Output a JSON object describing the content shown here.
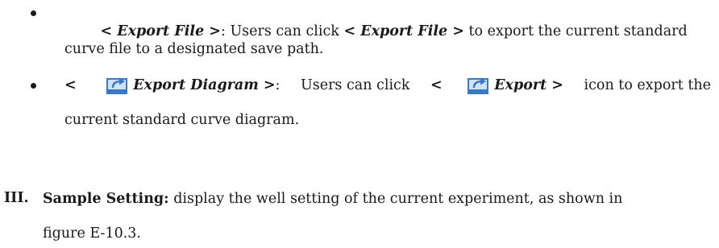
{
  "bullets": [
    {
      "lead_label": "< Export File >",
      "colon": ":",
      "line1_text": " Users can click ",
      "inline_label": "< Export File >",
      "line1_tail": " to export the current standard",
      "line2_text": "curve file to a designated save path."
    },
    {
      "open_bracket": "<",
      "lead_label": "Export Diagram >",
      "colon": ":",
      "mid_text": "Users can click",
      "inline_open": "<",
      "inline_label": "Export >",
      "tail_text": "icon to export the",
      "line2_text": "current standard curve diagram."
    }
  ],
  "section": {
    "numeral": "III.",
    "title": "Sample Setting:",
    "line1_text": " display the well setting of the current experiment, as shown in",
    "line2_text": "figure E-10.3."
  },
  "icons": {
    "export": "export-icon",
    "bullet": "bullet-icon"
  },
  "colors": {
    "text": "#1a1a1a",
    "icon_blue": "#3a78c8",
    "icon_light": "#cfe2f7"
  }
}
